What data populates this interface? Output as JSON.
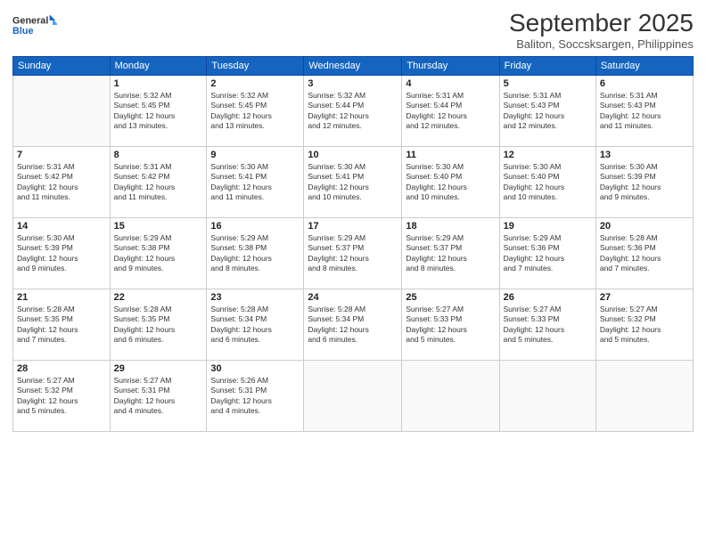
{
  "logo": {
    "line1": "General",
    "line2": "Blue"
  },
  "title": "September 2025",
  "subtitle": "Baliton, Soccsksargen, Philippines",
  "days_of_week": [
    "Sunday",
    "Monday",
    "Tuesday",
    "Wednesday",
    "Thursday",
    "Friday",
    "Saturday"
  ],
  "weeks": [
    [
      {
        "day": "",
        "info": ""
      },
      {
        "day": "1",
        "info": "Sunrise: 5:32 AM\nSunset: 5:45 PM\nDaylight: 12 hours\nand 13 minutes."
      },
      {
        "day": "2",
        "info": "Sunrise: 5:32 AM\nSunset: 5:45 PM\nDaylight: 12 hours\nand 13 minutes."
      },
      {
        "day": "3",
        "info": "Sunrise: 5:32 AM\nSunset: 5:44 PM\nDaylight: 12 hours\nand 12 minutes."
      },
      {
        "day": "4",
        "info": "Sunrise: 5:31 AM\nSunset: 5:44 PM\nDaylight: 12 hours\nand 12 minutes."
      },
      {
        "day": "5",
        "info": "Sunrise: 5:31 AM\nSunset: 5:43 PM\nDaylight: 12 hours\nand 12 minutes."
      },
      {
        "day": "6",
        "info": "Sunrise: 5:31 AM\nSunset: 5:43 PM\nDaylight: 12 hours\nand 11 minutes."
      }
    ],
    [
      {
        "day": "7",
        "info": "Sunrise: 5:31 AM\nSunset: 5:42 PM\nDaylight: 12 hours\nand 11 minutes."
      },
      {
        "day": "8",
        "info": "Sunrise: 5:31 AM\nSunset: 5:42 PM\nDaylight: 12 hours\nand 11 minutes."
      },
      {
        "day": "9",
        "info": "Sunrise: 5:30 AM\nSunset: 5:41 PM\nDaylight: 12 hours\nand 11 minutes."
      },
      {
        "day": "10",
        "info": "Sunrise: 5:30 AM\nSunset: 5:41 PM\nDaylight: 12 hours\nand 10 minutes."
      },
      {
        "day": "11",
        "info": "Sunrise: 5:30 AM\nSunset: 5:40 PM\nDaylight: 12 hours\nand 10 minutes."
      },
      {
        "day": "12",
        "info": "Sunrise: 5:30 AM\nSunset: 5:40 PM\nDaylight: 12 hours\nand 10 minutes."
      },
      {
        "day": "13",
        "info": "Sunrise: 5:30 AM\nSunset: 5:39 PM\nDaylight: 12 hours\nand 9 minutes."
      }
    ],
    [
      {
        "day": "14",
        "info": "Sunrise: 5:30 AM\nSunset: 5:39 PM\nDaylight: 12 hours\nand 9 minutes."
      },
      {
        "day": "15",
        "info": "Sunrise: 5:29 AM\nSunset: 5:38 PM\nDaylight: 12 hours\nand 9 minutes."
      },
      {
        "day": "16",
        "info": "Sunrise: 5:29 AM\nSunset: 5:38 PM\nDaylight: 12 hours\nand 8 minutes."
      },
      {
        "day": "17",
        "info": "Sunrise: 5:29 AM\nSunset: 5:37 PM\nDaylight: 12 hours\nand 8 minutes."
      },
      {
        "day": "18",
        "info": "Sunrise: 5:29 AM\nSunset: 5:37 PM\nDaylight: 12 hours\nand 8 minutes."
      },
      {
        "day": "19",
        "info": "Sunrise: 5:29 AM\nSunset: 5:36 PM\nDaylight: 12 hours\nand 7 minutes."
      },
      {
        "day": "20",
        "info": "Sunrise: 5:28 AM\nSunset: 5:36 PM\nDaylight: 12 hours\nand 7 minutes."
      }
    ],
    [
      {
        "day": "21",
        "info": "Sunrise: 5:28 AM\nSunset: 5:35 PM\nDaylight: 12 hours\nand 7 minutes."
      },
      {
        "day": "22",
        "info": "Sunrise: 5:28 AM\nSunset: 5:35 PM\nDaylight: 12 hours\nand 6 minutes."
      },
      {
        "day": "23",
        "info": "Sunrise: 5:28 AM\nSunset: 5:34 PM\nDaylight: 12 hours\nand 6 minutes."
      },
      {
        "day": "24",
        "info": "Sunrise: 5:28 AM\nSunset: 5:34 PM\nDaylight: 12 hours\nand 6 minutes."
      },
      {
        "day": "25",
        "info": "Sunrise: 5:27 AM\nSunset: 5:33 PM\nDaylight: 12 hours\nand 5 minutes."
      },
      {
        "day": "26",
        "info": "Sunrise: 5:27 AM\nSunset: 5:33 PM\nDaylight: 12 hours\nand 5 minutes."
      },
      {
        "day": "27",
        "info": "Sunrise: 5:27 AM\nSunset: 5:32 PM\nDaylight: 12 hours\nand 5 minutes."
      }
    ],
    [
      {
        "day": "28",
        "info": "Sunrise: 5:27 AM\nSunset: 5:32 PM\nDaylight: 12 hours\nand 5 minutes."
      },
      {
        "day": "29",
        "info": "Sunrise: 5:27 AM\nSunset: 5:31 PM\nDaylight: 12 hours\nand 4 minutes."
      },
      {
        "day": "30",
        "info": "Sunrise: 5:26 AM\nSunset: 5:31 PM\nDaylight: 12 hours\nand 4 minutes."
      },
      {
        "day": "",
        "info": ""
      },
      {
        "day": "",
        "info": ""
      },
      {
        "day": "",
        "info": ""
      },
      {
        "day": "",
        "info": ""
      }
    ]
  ]
}
